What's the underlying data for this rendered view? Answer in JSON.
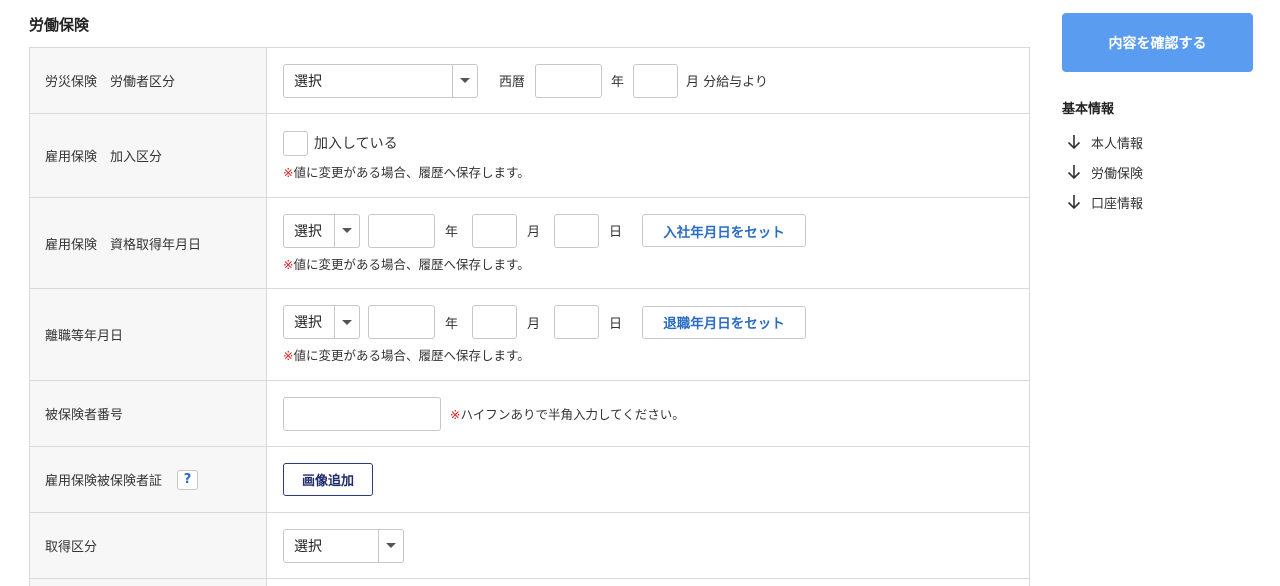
{
  "section_title": "労働保険",
  "confirm_button": "内容を確認する",
  "side_nav": {
    "title": "基本情報",
    "items": [
      "本人情報",
      "労働保険",
      "口座情報"
    ]
  },
  "common": {
    "select_placeholder": "選択",
    "note_mark": "※",
    "history_note": "値に変更がある場合、履歴へ保存します。"
  },
  "rows": {
    "rousai": {
      "label": "労災保険　労働者区分",
      "era": "西暦",
      "year": "年",
      "month_suffix": "月 分給与より"
    },
    "koyo_kanyu": {
      "label": "雇用保険　加入区分",
      "checkbox_label": "加入している"
    },
    "koyo_shikaku": {
      "label": "雇用保険　資格取得年月日",
      "year": "年",
      "month": "月",
      "day": "日",
      "set_button": "入社年月日をセット"
    },
    "rishoku": {
      "label": "離職等年月日",
      "year": "年",
      "month": "月",
      "day": "日",
      "set_button": "退職年月日をセット"
    },
    "hihokensha_bango": {
      "label": "被保険者番号",
      "note": "ハイフンありで半角入力してください。"
    },
    "hihokensha_sho": {
      "label": "雇用保険被保険者証",
      "help": "?",
      "add_image_button": "画像追加"
    },
    "shutoku_kubun": {
      "label": "取得区分"
    }
  }
}
